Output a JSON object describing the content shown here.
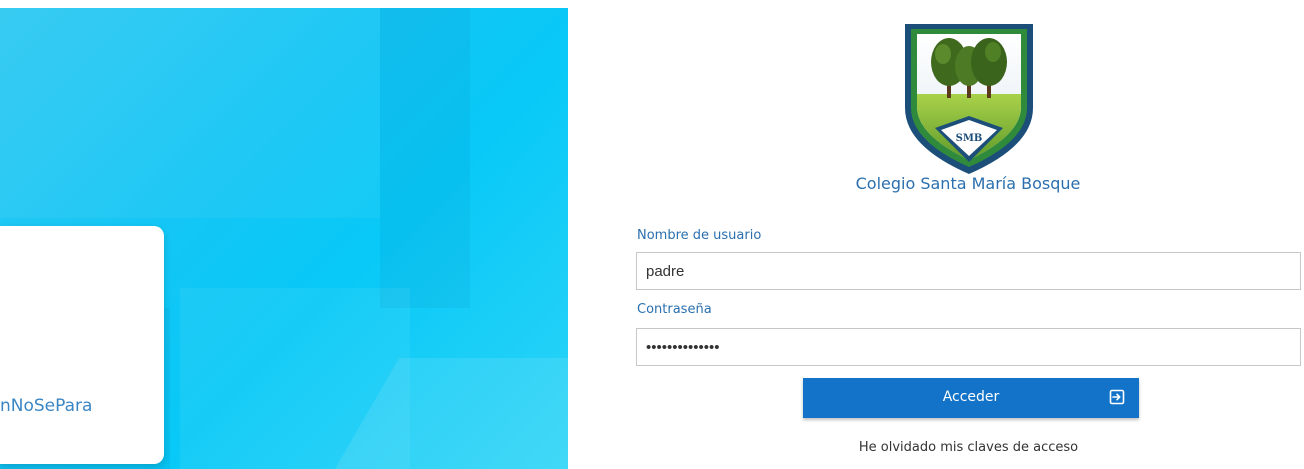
{
  "hero": {
    "hashtag": "nNoSePara"
  },
  "school": {
    "logo_text": "SMB",
    "name": "Colegio Santa María Bosque"
  },
  "form": {
    "username_label": "Nombre de usuario",
    "username_value": "padre",
    "password_label": "Contraseña",
    "password_value": "••••••••••••••",
    "submit_label": "Acceder",
    "forgot_label": "He olvidado mis claves de acceso"
  },
  "colors": {
    "primary": "#1273c8",
    "accent_text": "#2b6fae",
    "hero_bg": "#12c6f5"
  },
  "icons": {
    "submit": "enter-icon"
  }
}
